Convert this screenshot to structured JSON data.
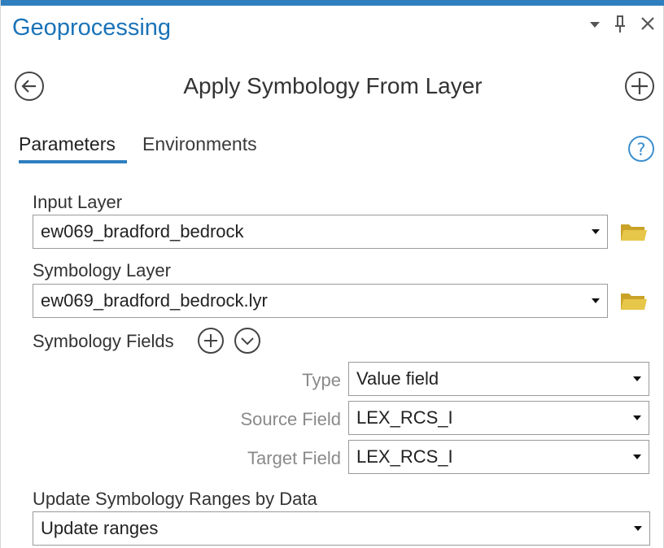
{
  "panel": {
    "title": "Geoprocessing",
    "accent_color": "#2f7fbf"
  },
  "window_controls": {
    "menu_icon": "caret-down-icon",
    "pin_icon": "pin-icon",
    "close_icon": "close-icon"
  },
  "tool": {
    "title": "Apply Symbology From Layer",
    "back_icon": "back-arrow-icon",
    "add_icon": "add-icon"
  },
  "tabs": [
    {
      "label": "Parameters",
      "active": true
    },
    {
      "label": "Environments",
      "active": false
    }
  ],
  "help_icon": "help-icon",
  "params": {
    "input_layer": {
      "label": "Input Layer",
      "value": "ew069_bradford_bedrock"
    },
    "symbology_layer": {
      "label": "Symbology Layer",
      "value": "ew069_bradford_bedrock.lyr"
    },
    "symbology_fields": {
      "label": "Symbology Fields",
      "type": {
        "label": "Type",
        "value": "Value field"
      },
      "source_field": {
        "label": "Source Field",
        "value": "LEX_RCS_I"
      },
      "target_field": {
        "label": "Target Field",
        "value": "LEX_RCS_I"
      }
    },
    "update_ranges": {
      "label": "Update Symbology Ranges by Data",
      "value": "Update ranges"
    }
  }
}
